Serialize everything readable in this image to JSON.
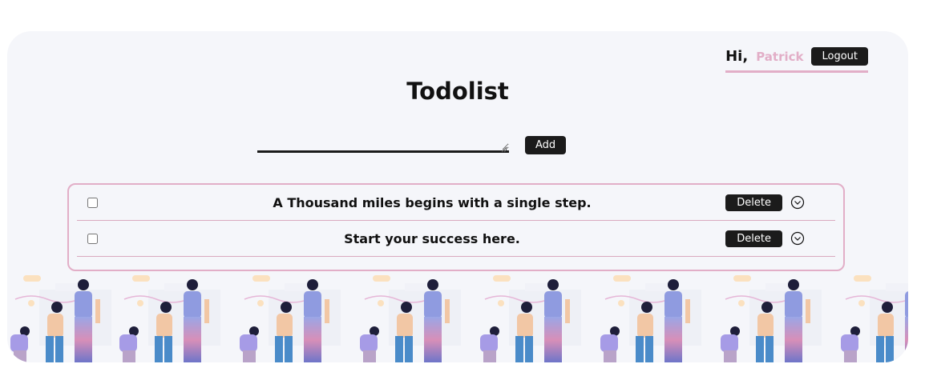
{
  "header": {
    "greeting": "Hi,",
    "username": "Patrick",
    "logout_label": "Logout"
  },
  "title": "Todolist",
  "form": {
    "input_value": "",
    "add_label": "Add"
  },
  "todos": [
    {
      "text": "A Thousand miles begins with a single step.",
      "checked": false,
      "delete_label": "Delete"
    },
    {
      "text": "Start your success here.",
      "checked": false,
      "delete_label": "Delete"
    }
  ],
  "colors": {
    "accent_pink": "#e2aec7",
    "button_dark": "#1b1b1b",
    "card_bg": "#f5f6fa"
  },
  "icons": {
    "expand": "chevron-down-circle-icon"
  }
}
